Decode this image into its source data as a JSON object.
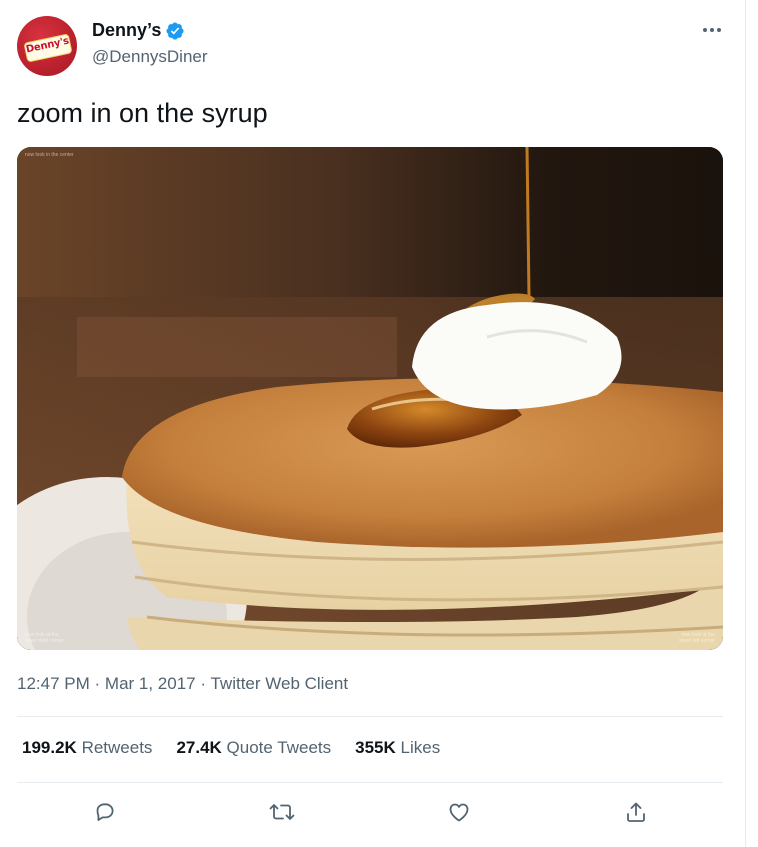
{
  "author": {
    "display_name": "Denny’s",
    "handle": "@DennysDiner",
    "logo_text": "Denny's",
    "verified_color": "#1d9bf0"
  },
  "tweet": {
    "text": "zoom in on the syrup",
    "media": {
      "caption_top_left": "now look in the center",
      "caption_bottom_left": "now look at the\nlower right corner",
      "caption_bottom_right": "now look at the\nlower left corner"
    }
  },
  "meta": {
    "time": "12:47 PM",
    "date": "Mar 1, 2017",
    "client": "Twitter Web Client",
    "separator": "·"
  },
  "stats": [
    {
      "count": "199.2K",
      "label": "Retweets"
    },
    {
      "count": "27.4K",
      "label": "Quote Tweets"
    },
    {
      "count": "355K",
      "label": "Likes"
    }
  ],
  "actions": [
    {
      "name": "reply",
      "icon": "reply-icon"
    },
    {
      "name": "retweet",
      "icon": "retweet-icon"
    },
    {
      "name": "like",
      "icon": "heart-icon"
    },
    {
      "name": "share",
      "icon": "share-icon"
    }
  ],
  "colors": {
    "text_primary": "#0f1419",
    "text_secondary": "#536471",
    "divider": "#e6ecf0",
    "brand_red": "#c8102e"
  }
}
